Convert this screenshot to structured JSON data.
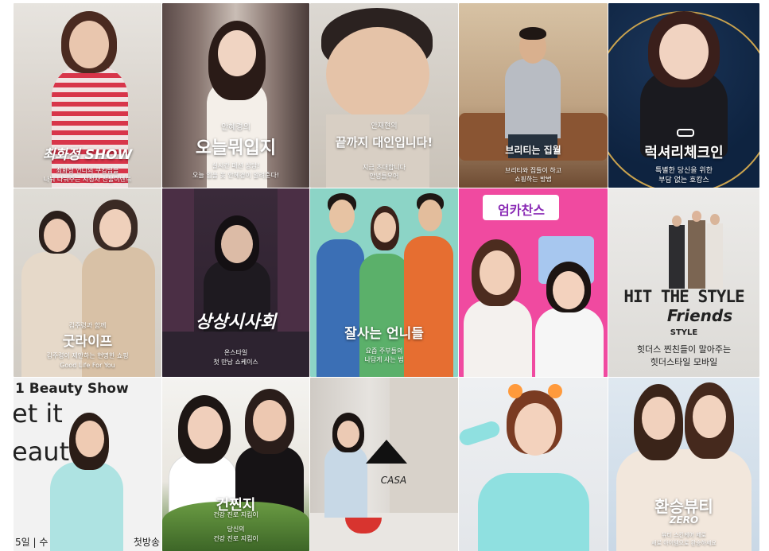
{
  "tiles": [
    {
      "title": "최화정 SHOW",
      "subtitle1": "최화정 언니의 쿠킹팁을",
      "subtitle2": "나눠 나눠주는 시청자 선물이벤트"
    },
    {
      "title": "오늘뭐입지",
      "kicker": "안혜경의",
      "subtitle1": "실시간 패션 상담!",
      "subtitle2": "오늘 입을 옷 안혜경이 알려준다!"
    },
    {
      "title": "끝까지 대인입니다!",
      "kicker": "안재현의",
      "subtitle1": "지금 초대합니다",
      "subtitle2": "안녕들우어"
    },
    {
      "title": "브리티는 집월",
      "subtitle1": "브리티와 집들이 하고",
      "subtitle2": "쇼핑하는 방법"
    },
    {
      "title": "럭셔리체크인",
      "subtitle1": "특별한 당신을 위한",
      "subtitle2": "부담 없는 호캉스"
    },
    {
      "title": "굿라이프",
      "kicker": "김주령과 함께",
      "subtitle1": "김주령이 제안하는 현명한 쇼핑",
      "subtitle2": "Good Life For You"
    },
    {
      "title": "상상시사회",
      "subtitle1": "온스타일",
      "subtitle2": "첫 만남 쇼케이스"
    },
    {
      "title": "잘사는 언니들",
      "subtitle1": "요즘 주부들의",
      "subtitle2": "나답게 사는 법"
    },
    {
      "title": "엄카찬스",
      "subtitle1": "",
      "subtitle2": ""
    },
    {
      "title": "HIT THE STYLE",
      "title2": "Friends",
      "title3": "STYLE",
      "subtitle1": "힛더스 찐친들이 말아주는",
      "subtitle2": "힛더스타일 모바일"
    },
    {
      "title": "1 Beauty Show",
      "title2": "et it",
      "title3": "eauty",
      "subtitle1": "5일 | 수",
      "subtitle2": "첫방송"
    },
    {
      "title": "건찐지",
      "kicker": "건강 진로 지킴이",
      "subtitle1": "당신의",
      "subtitle2": "건강 진로 지킴이"
    },
    {
      "title": "CASA",
      "subtitle1": "",
      "subtitle2": ""
    },
    {
      "title": "",
      "subtitle1": "",
      "subtitle2": ""
    },
    {
      "title": "환승뷰티",
      "title2": "ZERO",
      "subtitle1": "뷰티 스킨케어 제로",
      "subtitle2": "새로 아이템으로 환승하세요"
    }
  ]
}
